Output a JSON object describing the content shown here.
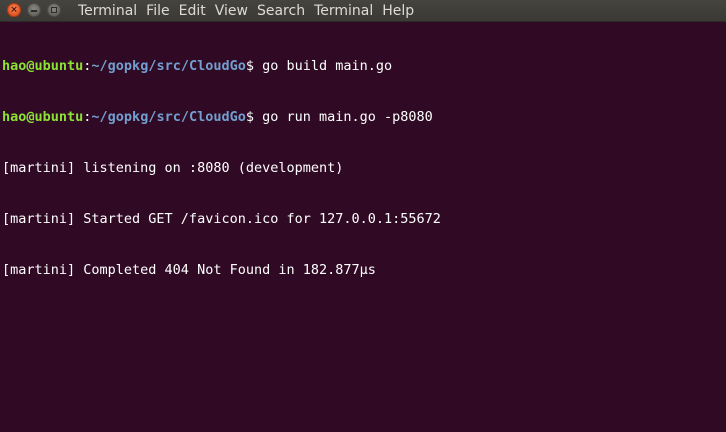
{
  "colors": {
    "background": "#300a24",
    "prompt_user": "#8ae234",
    "prompt_path": "#729fcf",
    "text": "#ffffff",
    "menubar": "#3c3b37",
    "close_button": "#e95420"
  },
  "window_controls": {
    "close_glyph": "×",
    "close_icon": "close-icon",
    "minimize_icon": "minimize-icon",
    "maximize_icon": "maximize-icon"
  },
  "menubar": {
    "app_title": "Terminal",
    "items": [
      "File",
      "Edit",
      "View",
      "Search",
      "Terminal",
      "Help"
    ]
  },
  "terminal": {
    "lines": [
      {
        "type": "prompt",
        "user_host": "hao@ubuntu",
        "separator": ":",
        "path": "~/gopkg/src/CloudGo",
        "symbol": "$ ",
        "command": "go build main.go"
      },
      {
        "type": "prompt",
        "user_host": "hao@ubuntu",
        "separator": ":",
        "path": "~/gopkg/src/CloudGo",
        "symbol": "$ ",
        "command": "go run main.go -p8080"
      },
      {
        "type": "output",
        "text": "[martini] listening on :8080 (development)"
      },
      {
        "type": "output",
        "text": "[martini] Started GET /favicon.ico for 127.0.0.1:55672"
      },
      {
        "type": "output",
        "text": "[martini] Completed 404 Not Found in 182.877µs"
      }
    ]
  }
}
